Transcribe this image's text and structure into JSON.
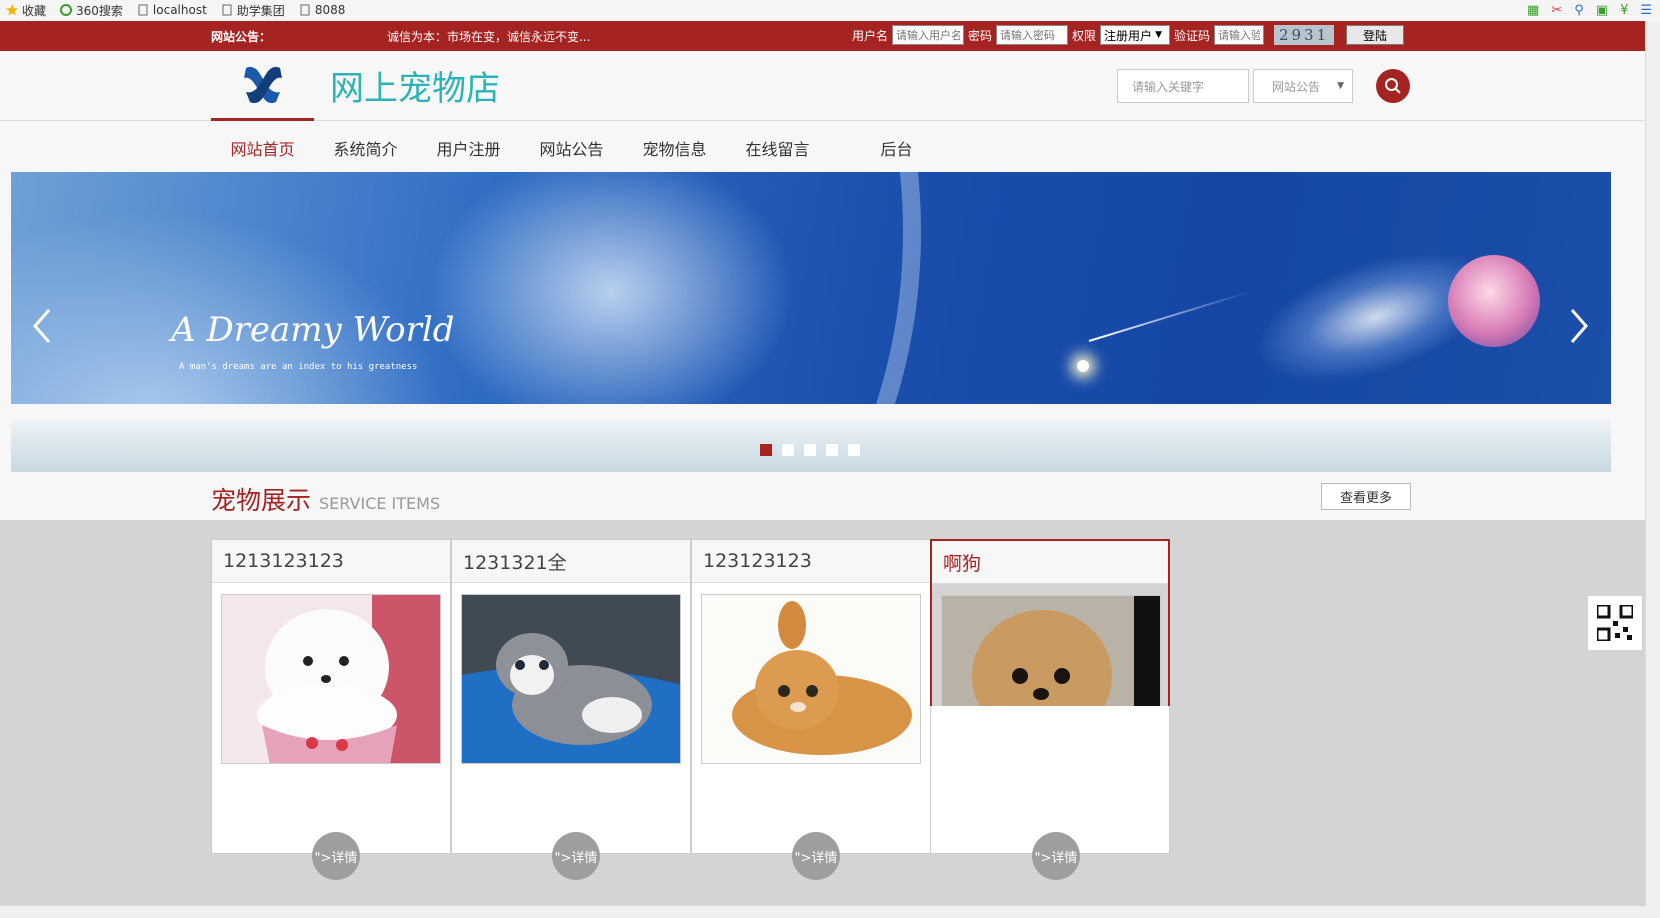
{
  "browser": {
    "bookmarks": [
      {
        "label": "收藏",
        "icon": "star-icon"
      },
      {
        "label": "360搜索",
        "icon": "360-logo-icon"
      },
      {
        "label": "localhost",
        "icon": "page-icon"
      },
      {
        "label": "助学集团",
        "icon": "page-icon"
      },
      {
        "label": "8088",
        "icon": "page-icon"
      }
    ]
  },
  "topbar": {
    "notice_label": "网站公告：",
    "notice_text": "诚信为本：市场在变，诚信永远不变...",
    "username_label": "用户名",
    "username_placeholder": "请输入用户名",
    "password_label": "密码",
    "password_placeholder": "请输入密码",
    "role_label": "权限",
    "role_value": "注册用户",
    "captcha_label": "验证码",
    "captcha_placeholder": "请输入验",
    "captcha_value": "2931",
    "login_button": "登陆"
  },
  "header": {
    "site_title": "网上宠物店",
    "search_placeholder": "请输入关键字",
    "search_category": "网站公告"
  },
  "nav": {
    "items": [
      "网站首页",
      "系统简介",
      "用户注册",
      "网站公告",
      "宠物信息",
      "在线留言",
      "后台"
    ],
    "active_index": 0
  },
  "banner": {
    "title": "A Dreamy World",
    "subtitle": "A man's dreams are an index to his greatness",
    "slide_count": 5,
    "active_slide": 0
  },
  "pets_section": {
    "title_cn": "宠物展示",
    "title_en": "SERVICE ITEMS",
    "more_button": "查看更多",
    "detail_label": "\">详情",
    "pets": [
      {
        "name": "1213123123",
        "image": "white-puppy-photo"
      },
      {
        "name": "1231321全",
        "image": "gray-kitten-photo"
      },
      {
        "name": "123123123",
        "image": "orange-kitten-photo"
      },
      {
        "name": "啊狗",
        "image": "pomeranian-photo"
      }
    ]
  },
  "colors": {
    "brand_red": "#a52422",
    "title_teal": "#2bb3b5"
  }
}
